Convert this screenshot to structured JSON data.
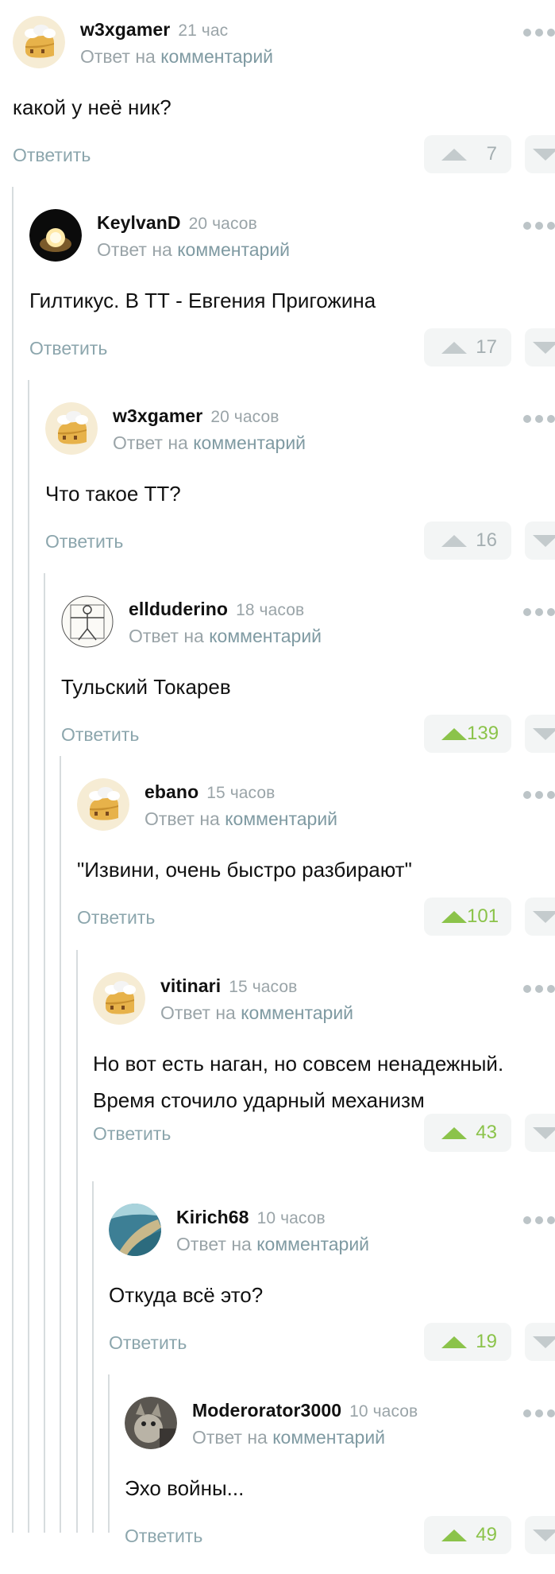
{
  "comments": [
    {
      "author": "w3xgamer",
      "time": "21 час",
      "reply_prefix": "Ответ на",
      "reply_link": "комментарий",
      "text": [
        "какой у неё ник?"
      ],
      "reply_label": "Ответить",
      "score": "7",
      "upvoted": false,
      "avatar": "cake-avatar"
    },
    {
      "author": "KeylvanD",
      "time": "20 часов",
      "reply_prefix": "Ответ на",
      "reply_link": "комментарий",
      "text": [
        "Гилтикус. В ТТ - Евгения Пригожина"
      ],
      "reply_label": "Ответить",
      "score": "17",
      "upvoted": false,
      "avatar": "light-avatar"
    },
    {
      "author": "w3xgamer",
      "time": "20 часов",
      "reply_prefix": "Ответ на",
      "reply_link": "комментарий",
      "text": [
        "Что такое ТТ?"
      ],
      "reply_label": "Ответить",
      "score": "16",
      "upvoted": false,
      "avatar": "cake-avatar"
    },
    {
      "author": "ellduderino",
      "time": "18 часов",
      "reply_prefix": "Ответ на",
      "reply_link": "комментарий",
      "text": [
        "Тульский Токарев"
      ],
      "reply_label": "Ответить",
      "score": "139",
      "upvoted": true,
      "avatar": "vitruvian-avatar"
    },
    {
      "author": "ebano",
      "time": "15 часов",
      "reply_prefix": "Ответ на",
      "reply_link": "комментарий",
      "text": [
        "\"Извини, очень быстро разбирают\""
      ],
      "reply_label": "Ответить",
      "score": "101",
      "upvoted": true,
      "avatar": "cake-avatar"
    },
    {
      "author": "vitinari",
      "time": "15 часов",
      "reply_prefix": "Ответ на",
      "reply_link": "комментарий",
      "text": [
        "Но вот есть наган, но совсем ненадежный.",
        "Время сточило ударный механизм"
      ],
      "reply_label": "Ответить",
      "score": "43",
      "upvoted": true,
      "avatar": "cake-avatar"
    },
    {
      "author": "Kirich68",
      "time": "10 часов",
      "reply_prefix": "Ответ на",
      "reply_link": "комментарий",
      "text": [
        "Откуда всё это?"
      ],
      "reply_label": "Ответить",
      "score": "19",
      "upvoted": true,
      "avatar": "sea-avatar"
    },
    {
      "author": "Moderorator3000",
      "time": "10 часов",
      "reply_prefix": "Ответ на",
      "reply_link": "комментарий",
      "text": [
        "Эхо войны..."
      ],
      "reply_label": "Ответить",
      "score": "49",
      "upvoted": true,
      "avatar": "cat-avatar"
    }
  ],
  "colors": {
    "accent_green": "#8bc34a",
    "muted": "#9aa4a8",
    "link": "#7f9aa2"
  }
}
